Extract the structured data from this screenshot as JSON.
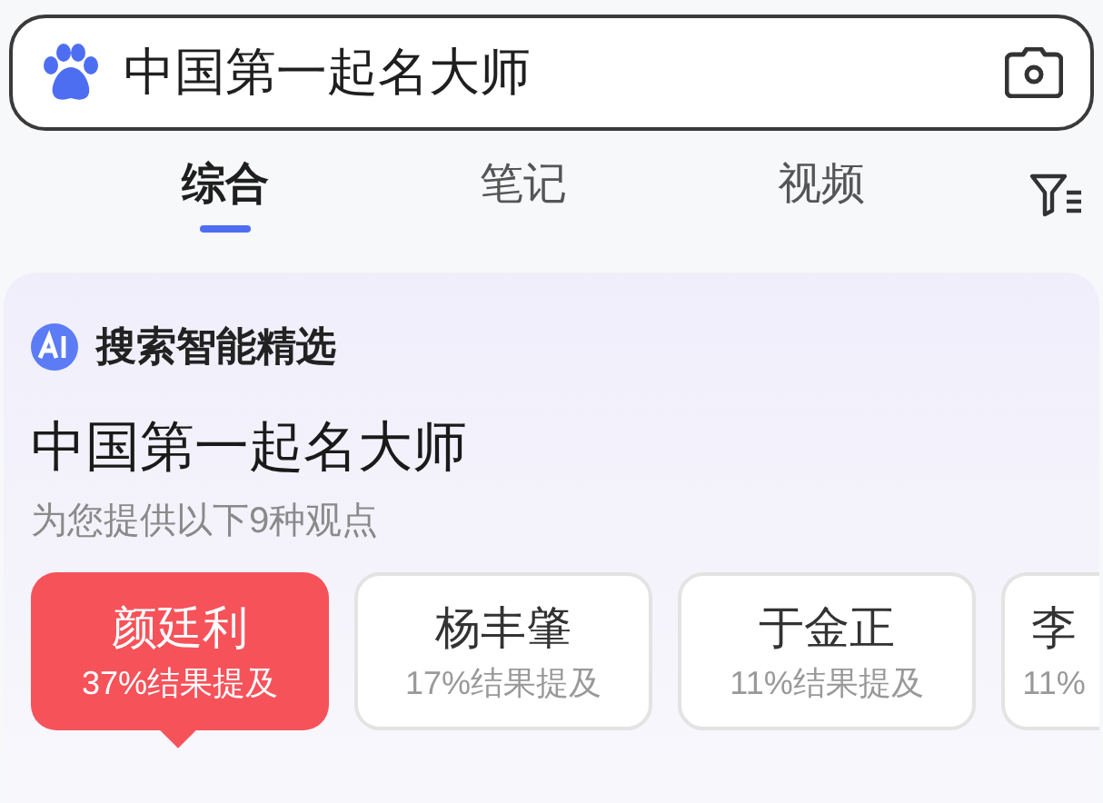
{
  "search": {
    "value": "中国第一起名大师"
  },
  "tabs": [
    {
      "label": "综合",
      "selected": true
    },
    {
      "label": "笔记",
      "selected": false
    },
    {
      "label": "视频",
      "selected": false
    }
  ],
  "ai_card": {
    "badge": "搜索智能精选",
    "title": "中国第一起名大师",
    "subtitle": "为您提供以下9种观点",
    "options": [
      {
        "name": "颜廷利",
        "mention": "37%结果提及",
        "selected": true
      },
      {
        "name": "杨丰肇",
        "mention": "17%结果提及",
        "selected": false
      },
      {
        "name": "于金正",
        "mention": "11%结果提及",
        "selected": false
      },
      {
        "name": "李",
        "mention": "11%",
        "selected": false
      }
    ]
  }
}
